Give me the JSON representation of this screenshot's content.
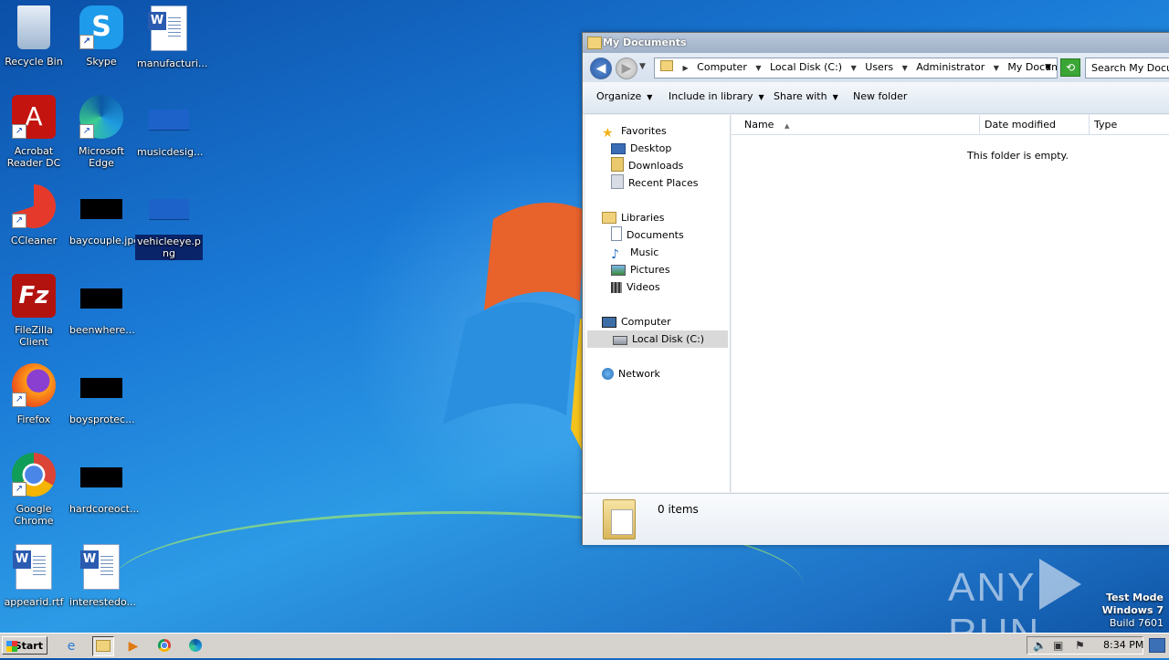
{
  "desktop": {
    "icons": [
      {
        "label": "Recycle Bin",
        "icon": "recycle-bin-icon"
      },
      {
        "label": "Skype",
        "icon": "skype-icon"
      },
      {
        "label": "manufacturi...",
        "icon": "word-document-icon"
      },
      {
        "label": "Acrobat Reader DC",
        "icon": "acrobat-icon"
      },
      {
        "label": "Microsoft Edge",
        "icon": "edge-icon"
      },
      {
        "label": "musicdesig...",
        "icon": "image-file-icon"
      },
      {
        "label": "CCleaner",
        "icon": "ccleaner-icon"
      },
      {
        "label": "baycouple.jpg",
        "icon": "image-file-icon"
      },
      {
        "label": "vehicleeye.png",
        "icon": "image-file-icon"
      },
      {
        "label": "FileZilla Client",
        "icon": "filezilla-icon"
      },
      {
        "label": "beenwhere...",
        "icon": "image-file-icon"
      },
      {
        "label": "Firefox",
        "icon": "firefox-icon"
      },
      {
        "label": "boysprotec...",
        "icon": "image-file-icon"
      },
      {
        "label": "Google Chrome",
        "icon": "chrome-icon"
      },
      {
        "label": "hardcoreoct...",
        "icon": "image-file-icon"
      },
      {
        "label": "appearid.rtf",
        "icon": "word-document-icon"
      },
      {
        "label": "interestedo...",
        "icon": "word-document-icon"
      }
    ]
  },
  "explorer": {
    "title": "My Documents",
    "address": {
      "crumbs": [
        "Computer",
        "Local Disk (C:)",
        "Users",
        "Administrator",
        "My Documents"
      ]
    },
    "search_placeholder": "Search My Documents",
    "toolbar": {
      "organize": "Organize",
      "include_in_library": "Include in library",
      "share_with": "Share with",
      "new_folder": "New folder"
    },
    "nav": {
      "favorites": "Favorites",
      "desktop": "Desktop",
      "downloads": "Downloads",
      "recent_places": "Recent Places",
      "libraries": "Libraries",
      "documents": "Documents",
      "music": "Music",
      "pictures": "Pictures",
      "videos": "Videos",
      "computer": "Computer",
      "local_disk": "Local Disk (C:)",
      "network": "Network"
    },
    "columns": {
      "name": "Name",
      "date_modified": "Date modified",
      "type": "Type"
    },
    "empty_message": "This folder is empty.",
    "item_count": "0 items"
  },
  "watermark": {
    "brand_left": "ANY",
    "brand_right": "RUN",
    "test_mode": "Test Mode",
    "os": "Windows 7",
    "build": "Build 7601"
  },
  "taskbar": {
    "start_label": "Start",
    "clock": "8:34 PM"
  }
}
